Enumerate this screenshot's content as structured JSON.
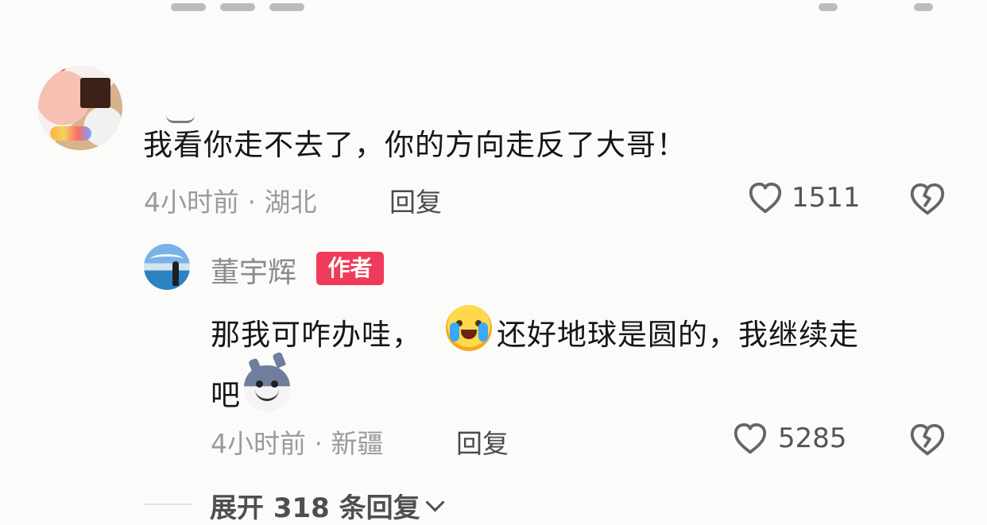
{
  "comment": {
    "text": "我看你走不去了，你的方向走反了大哥！",
    "time": "4小时前",
    "location": "湖北",
    "reply_label": "回复",
    "likes": "1511",
    "avatar_icon": "user-avatar",
    "like_icon": "heart-icon",
    "dislike_icon": "broken-heart-icon"
  },
  "reply": {
    "author_name": "董宇辉",
    "badge": "作者",
    "text_before_emoji": "那我可咋办哇，",
    "text_after_emoji": "还好地球是圆的，我继续走",
    "text_line2": "吧",
    "time": "4小时前",
    "location": "新疆",
    "reply_label": "回复",
    "likes": "5285",
    "avatar_icon": "author-avatar",
    "emoji_1": "crying-face-emoji",
    "emoji_2": "wolf-face-emoji",
    "like_icon": "heart-icon",
    "dislike_icon": "broken-heart-icon"
  },
  "thread": {
    "expand_label": "展开 318 条回复",
    "chevron_icon": "chevron-down-icon"
  },
  "colors": {
    "background": "#fbfbf9",
    "badge": "#ef3b5b",
    "muted_text": "#9b9b9b"
  }
}
